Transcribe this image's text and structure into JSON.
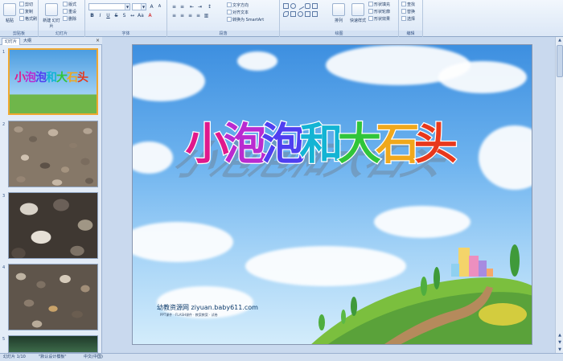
{
  "ribbon": {
    "groups": [
      {
        "id": "clipboard",
        "label": "剪贴板"
      },
      {
        "id": "slides",
        "label": "幻灯片"
      },
      {
        "id": "font",
        "label": "字体"
      },
      {
        "id": "paragraph",
        "label": "段落"
      },
      {
        "id": "drawing",
        "label": "绘图"
      },
      {
        "id": "editing",
        "label": "编辑"
      }
    ],
    "paste": "粘贴",
    "cut": "剪切",
    "copy": "复制",
    "format_painter": "格式刷",
    "new_slide": "新建 幻灯片",
    "layout": "版式",
    "reset": "重设",
    "delete": "删除",
    "text_direction": "文字方向",
    "align_text": "对齐文本",
    "smartart": "转换为 SmartArt",
    "arrange": "排列",
    "quick_styles": "快速样式",
    "shape_fill": "形状填充",
    "shape_outline": "形状轮廓",
    "shape_effects": "形状效果",
    "find": "查找",
    "replace": "替换",
    "select": "选择"
  },
  "panel": {
    "tab_slides": "幻灯片",
    "tab_outline": "大纲",
    "close": "×",
    "slides": [
      {
        "num": "1",
        "title": "小泡泡和大石头"
      },
      {
        "num": "2"
      },
      {
        "num": "3"
      },
      {
        "num": "4"
      },
      {
        "num": "5"
      }
    ]
  },
  "slide": {
    "title": "小泡泡和大石头",
    "title_chars": [
      "小",
      "泡",
      "泡",
      "和",
      "大",
      "石",
      "头"
    ],
    "title_colors": [
      "#e0198c",
      "#b92bd0",
      "#4f3ff0",
      "#13b4d4",
      "#30c53a",
      "#f0a81c",
      "#e8381c"
    ],
    "watermark": "幼教资源网 ziyuan.baby611.com",
    "watermark_sub": "PPT课件 · FLASH课件 · 教案教案 · 试卷"
  },
  "status": {
    "slide_pos": "幻灯片 1/10",
    "theme": "\"默认设计模板\"",
    "language": "中文(中国)"
  }
}
